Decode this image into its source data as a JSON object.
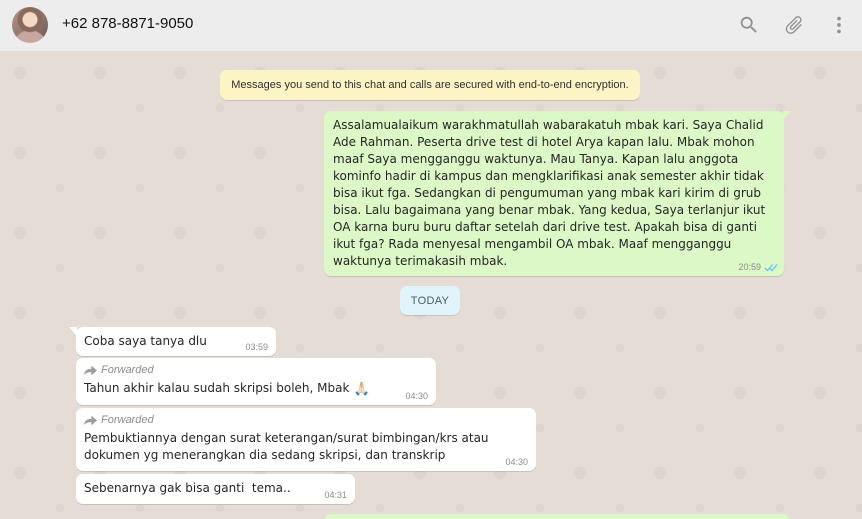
{
  "header": {
    "contact_name": "+62 878-8871-9050",
    "icons": [
      "search-icon",
      "attach-icon",
      "menu-icon"
    ]
  },
  "chat": {
    "encryption_notice": "Messages you send to this chat and calls are secured with end-to-end encryption.",
    "date_separator": "TODAY",
    "messages": [
      {
        "direction": "outgoing",
        "text": "Assalamualaikum warakhmatullah wabarakatuh mbak kari. Saya Chalid Ade Rahman. Peserta drive test di hotel Arya kapan lalu. Mbak mohon maaf Saya mengganggu waktunya. Mau Tanya. Kapan lalu anggota kominfo hadir di kampus dan mengklarifikasi anak semester akhir tidak bisa ikut fga. Sedangkan di pengumuman yang mbak kari kirim di grub bisa. Lalu bagaimana yang benar mbak. Yang kedua, Saya terlanjur ikut OA karna buru buru daftar setelah dari drive test. Apakah bisa di ganti ikut fga? Rada menyesal mengambil OA mbak. Maaf mengganggu waktunya terimakasih mbak.",
        "time": "20:59",
        "status": "read"
      },
      {
        "direction": "incoming",
        "text": "Coba saya tanya dlu",
        "time": "03:59"
      },
      {
        "direction": "incoming",
        "forwarded_label": "Forwarded",
        "text": "Tahun akhir kalau sudah skripsi boleh, Mbak",
        "emoji": "🙏🏻",
        "time": "04:30"
      },
      {
        "direction": "incoming",
        "forwarded_label": "Forwarded",
        "text": "Pembuktiannya dengan surat keterangan/surat bimbingan/krs atau dokumen yg menerangkan dia sedang skripsi, dan transkrip",
        "time": "04:30"
      },
      {
        "direction": "incoming",
        "text": "Sebenarnya gak bisa ganti  tema..",
        "time": "04:31"
      }
    ]
  },
  "colors": {
    "header_bg": "#ededed",
    "chat_bg": "#e5ddd5",
    "outgoing_bubble": "#dcf8c6",
    "incoming_bubble": "#ffffff",
    "notice_bg": "#fdf4c5",
    "read_ticks": "#4fc3f7"
  }
}
